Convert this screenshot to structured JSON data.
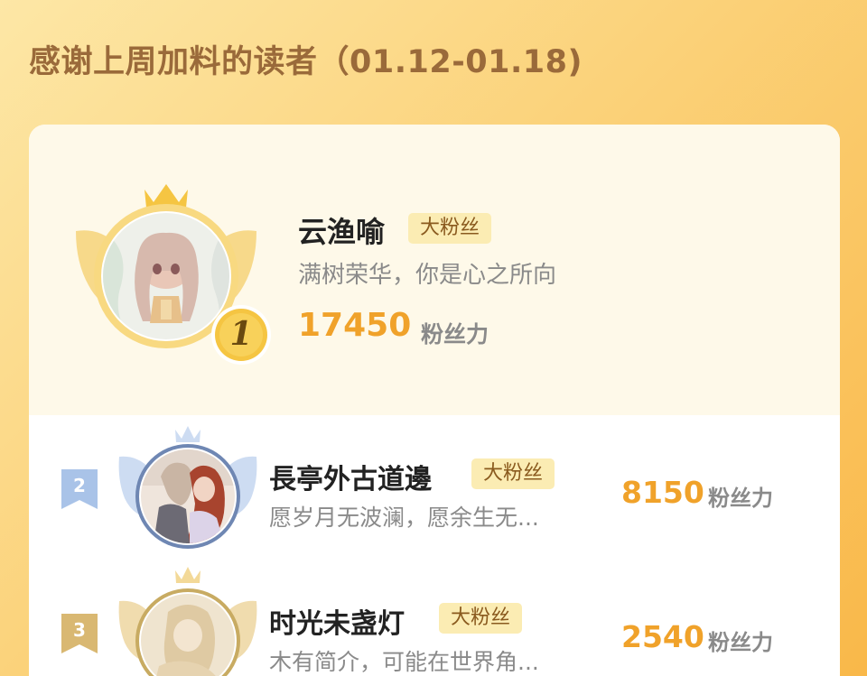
{
  "heading": "感谢上周加料的读者（01.12-01.18)",
  "ranking": [
    {
      "rank": "1",
      "name": "云渔喻",
      "badge": "大粉丝",
      "motto": "满树荣华，你是心之所向",
      "score": "17450",
      "unit": "粉丝力"
    },
    {
      "rank": "2",
      "name": "長亭外古道邊",
      "badge": "大粉丝",
      "motto": "愿岁月无波澜，愿余生无...",
      "score": "8150",
      "unit": "粉丝力"
    },
    {
      "rank": "3",
      "name": "时光未盏灯",
      "badge": "大粉丝",
      "motto": "木有简介，可能在世界角...",
      "score": "2540",
      "unit": "粉丝力"
    }
  ],
  "colors": {
    "accent": "#f0a22a",
    "gold": "#f5c542",
    "silver_blue": "#a9c3e8",
    "bronze": "#d9b872"
  },
  "icons": {
    "crown": "crown-icon",
    "wings": "wings-icon",
    "rank_medal": "medal-icon",
    "rank_flag": "ribbon-flag-icon"
  }
}
